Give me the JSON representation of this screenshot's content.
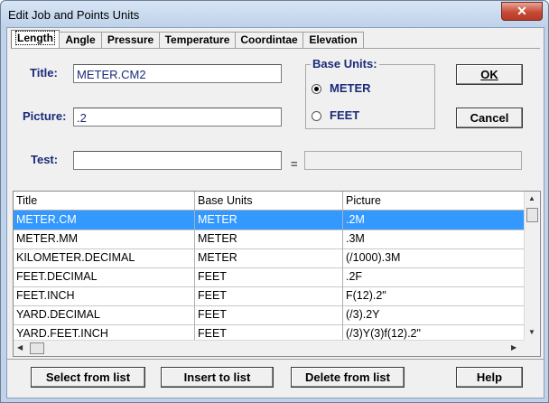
{
  "window": {
    "title": "Edit Job and Points Units",
    "close_label": "✕"
  },
  "tabs": [
    "Length",
    "Angle",
    "Pressure",
    "Temperature",
    "Coordintae",
    "Elevation"
  ],
  "form": {
    "title_label": "Title:",
    "title_value": "METER.CM2",
    "picture_label": "Picture:",
    "picture_value": ".2",
    "test_label": "Test:",
    "test_value": "",
    "equals": "=",
    "result_value": ""
  },
  "base_units": {
    "legend": "Base Units:",
    "options": [
      "METER",
      "FEET"
    ],
    "selected": "METER"
  },
  "buttons": {
    "ok": "OK",
    "cancel": "Cancel"
  },
  "table": {
    "columns": [
      "Title",
      "Base Units",
      "Picture"
    ],
    "rows": [
      [
        "METER.CM",
        "METER",
        ".2M"
      ],
      [
        "METER.MM",
        "METER",
        ".3M"
      ],
      [
        "KILOMETER.DECIMAL",
        "METER",
        "(/1000).3M"
      ],
      [
        "FEET.DECIMAL",
        "FEET",
        ".2F"
      ],
      [
        "FEET.INCH",
        "FEET",
        "F(12).2\""
      ],
      [
        "YARD.DECIMAL",
        "FEET",
        "(/3).2Y"
      ],
      [
        "YARD.FEET.INCH",
        "FEET",
        "(/3)Y(3)f(12).2\""
      ]
    ],
    "selected_row": 0
  },
  "actions": {
    "select_from_list": "Select from list",
    "insert_to_list": "Insert to list",
    "delete_from_list": "Delete from list",
    "help": "Help"
  },
  "colors": {
    "selection": "#3399ff",
    "label_text": "#1a2a7a",
    "close_button": "#c74a36"
  },
  "icons": [
    "close-icon",
    "radio-icon",
    "scroll-up-icon",
    "scroll-down-icon",
    "scroll-left-icon",
    "scroll-right-icon"
  ]
}
